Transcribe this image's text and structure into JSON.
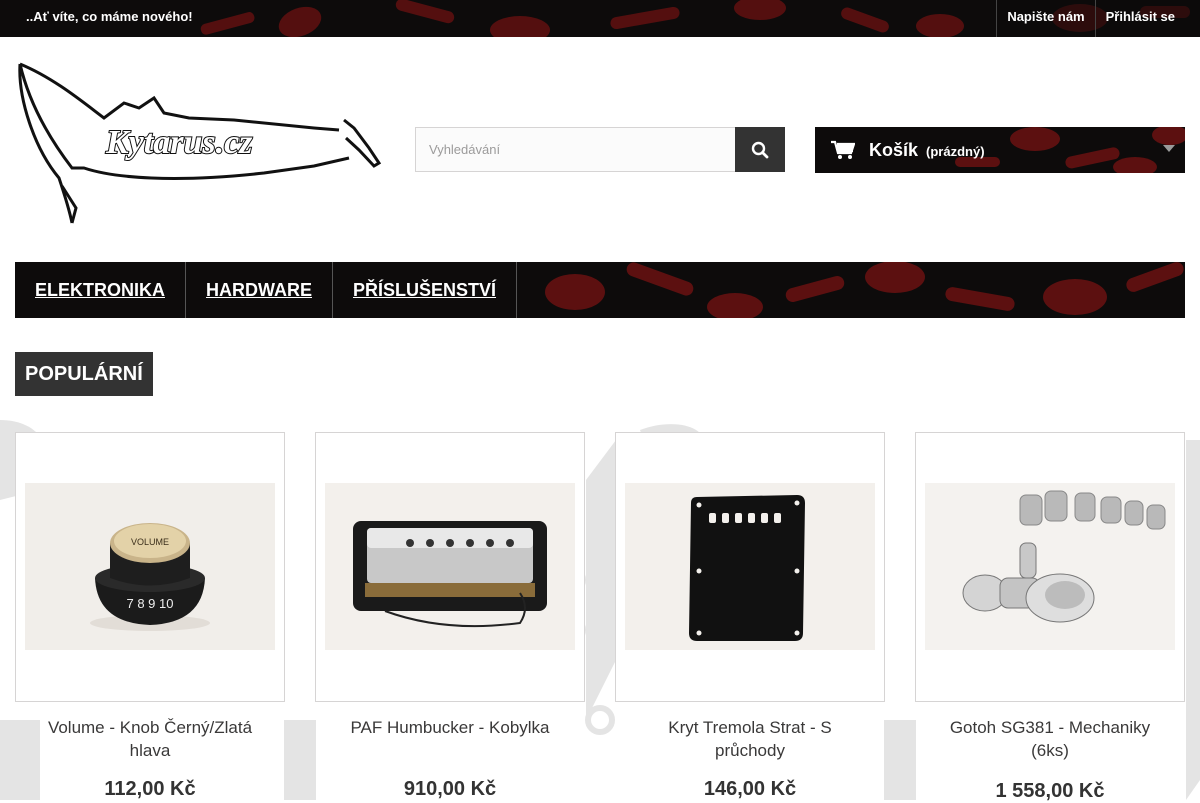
{
  "topbar": {
    "promo": "..Ať víte, co máme nového!",
    "links": [
      "Napište nám",
      "Přihlásit se"
    ]
  },
  "logo": {
    "text": "Kytarus.cz"
  },
  "search": {
    "placeholder": "Vyhledávání",
    "icon": "search-icon"
  },
  "cart": {
    "label": "Košík",
    "status": "(prázdný)",
    "icon": "cart-icon"
  },
  "nav": {
    "items": [
      "ELEKTRONIKA",
      "HARDWARE",
      "PŘÍSLUŠENSTVÍ"
    ]
  },
  "section": {
    "title": "POPULÁRNÍ"
  },
  "products": [
    {
      "name": "Volume - Knob Černý/Zlatá hlava",
      "price": "112,00 Kč",
      "knob_label": "VOLUME"
    },
    {
      "name": "PAF Humbucker - Kobylka",
      "price": "910,00 Kč"
    },
    {
      "name": "Kryt Tremola Strat - S průchody",
      "price": "146,00 Kč"
    },
    {
      "name": "Gotoh SG381 - Mechaniky (6ks)",
      "price": "1 558,00 Kč"
    }
  ],
  "colors": {
    "dark": "#0d0b0b",
    "pattern_red": "#7a1212",
    "button": "#333333"
  }
}
